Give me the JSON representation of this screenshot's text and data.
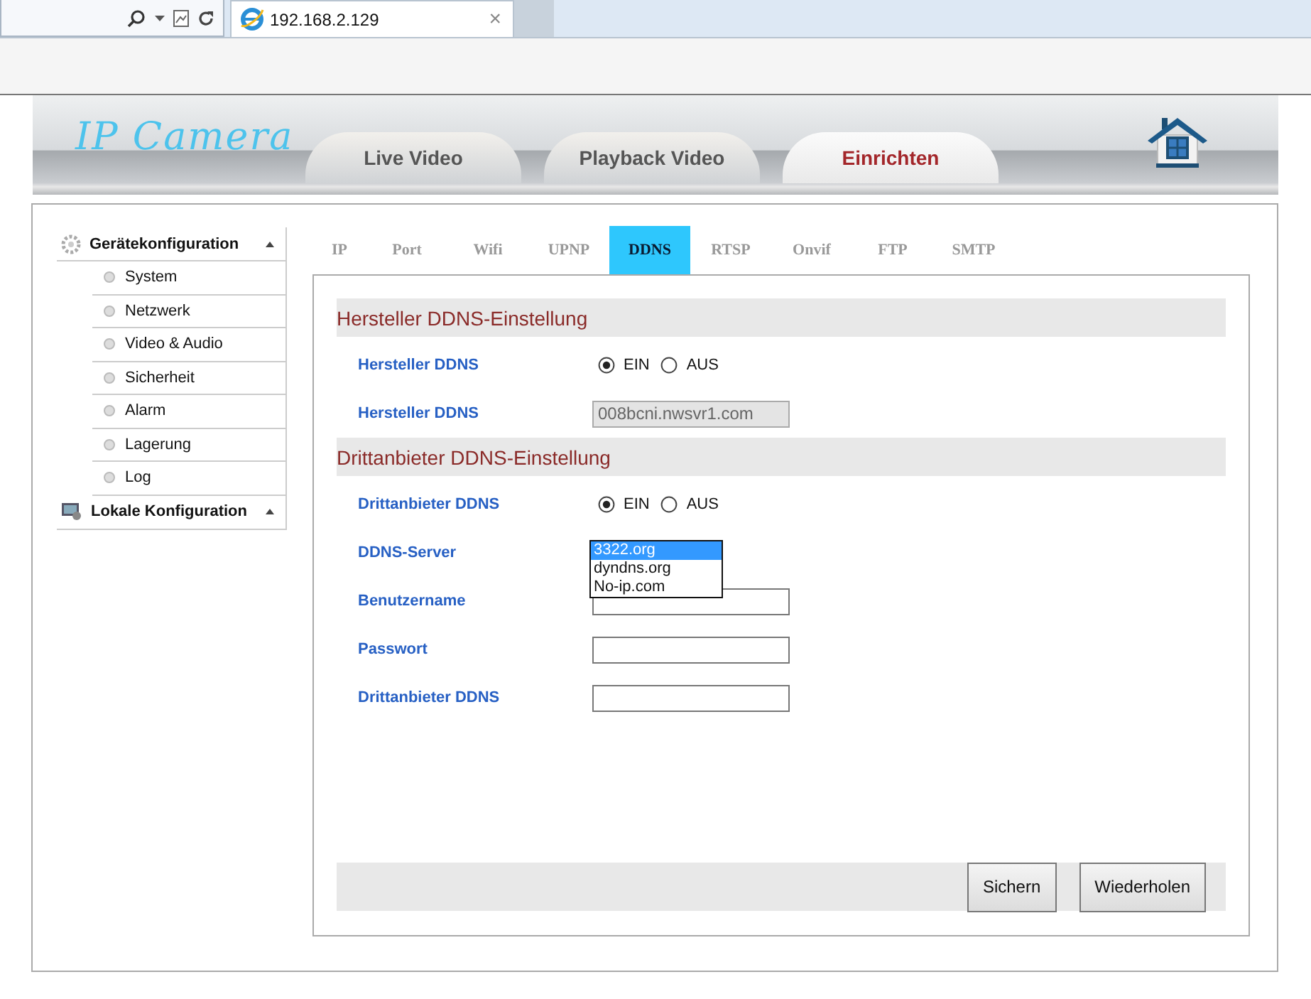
{
  "browser": {
    "tab_title": "192.168.2.129",
    "close": "×"
  },
  "header": {
    "logo": "IP Camera",
    "nav": [
      {
        "label": "Live Video",
        "selected": false
      },
      {
        "label": "Playback Video",
        "selected": false
      },
      {
        "label": "Einrichten",
        "selected": true
      }
    ]
  },
  "sidebar": {
    "groups": [
      {
        "kind": "gear",
        "label": "Gerätekonfiguration",
        "items": [
          "System",
          "Netzwerk",
          "Video & Audio",
          "Sicherheit",
          "Alarm",
          "Lagerung",
          "Log"
        ]
      },
      {
        "kind": "monitor",
        "label": "Lokale Konfiguration"
      }
    ]
  },
  "tabs": [
    {
      "label": "IP",
      "selected": false
    },
    {
      "label": "Port",
      "selected": false
    },
    {
      "label": "Wifi",
      "selected": false
    },
    {
      "label": "UPNP",
      "selected": false
    },
    {
      "label": "DDNS",
      "selected": true
    },
    {
      "label": "RTSP",
      "selected": false
    },
    {
      "label": "Onvif",
      "selected": false
    },
    {
      "label": "FTP",
      "selected": false
    },
    {
      "label": "SMTP",
      "selected": false
    }
  ],
  "sections": [
    {
      "title": "Hersteller DDNS-Einstellung",
      "fields": [
        {
          "kind": "radio",
          "label": "Hersteller DDNS",
          "options": [
            {
              "label": "EIN",
              "selected": true
            },
            {
              "label": "AUS",
              "selected": false
            }
          ]
        },
        {
          "kind": "text",
          "label": "Hersteller DDNS",
          "value": "008bcni.nwsvr1.com",
          "disabled": true
        }
      ]
    },
    {
      "title": "Drittanbieter DDNS-Einstellung",
      "fields": [
        {
          "kind": "radio",
          "label": "Drittanbieter DDNS",
          "options": [
            {
              "label": "EIN",
              "selected": true
            },
            {
              "label": "AUS",
              "selected": false
            }
          ]
        },
        {
          "kind": "select",
          "label": "DDNS-Server",
          "options": [
            {
              "label": "3322.org",
              "selected": true
            },
            {
              "label": "dyndns.org",
              "selected": false
            },
            {
              "label": "No-ip.com",
              "selected": false
            }
          ]
        },
        {
          "kind": "text",
          "label": "Benutzername",
          "disabled": false
        },
        {
          "kind": "text",
          "label": "Passwort",
          "disabled": false
        },
        {
          "kind": "text",
          "label": "Drittanbieter DDNS",
          "disabled": false
        }
      ]
    }
  ],
  "buttons": [
    "Sichern",
    "Wiederholen"
  ]
}
